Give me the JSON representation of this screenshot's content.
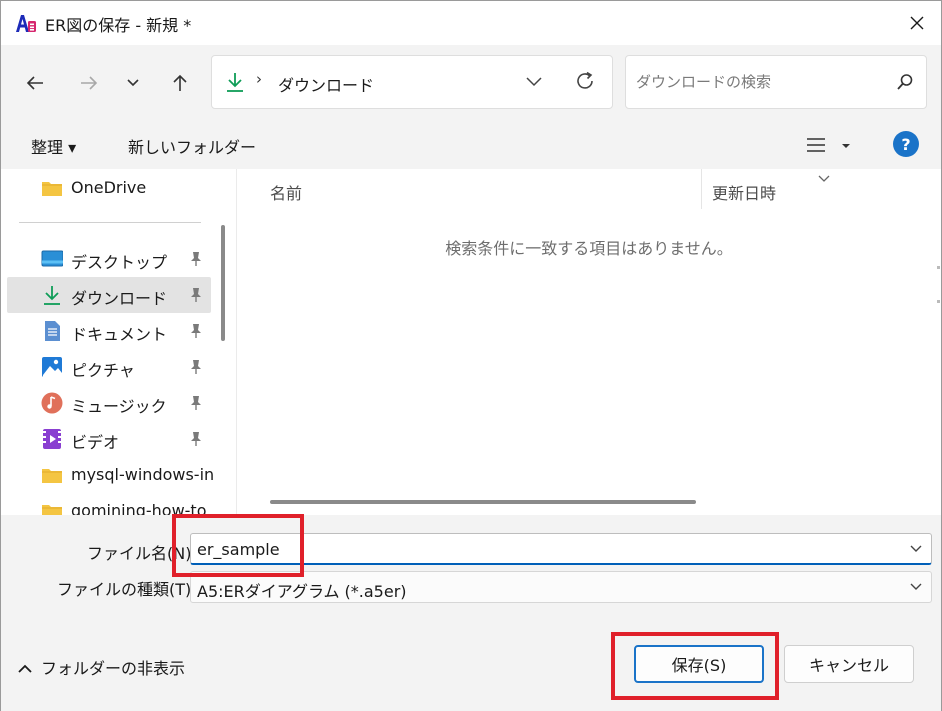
{
  "window": {
    "title": "ER図の保存 - 新規 *",
    "app_icon": "a5er-app-icon",
    "close_icon": "close-icon"
  },
  "nav": {
    "back_icon": "arrow-left-icon",
    "forward_icon": "arrow-right-icon",
    "recent_icon": "chevron-down-icon",
    "up_icon": "arrow-up-icon",
    "address": {
      "location_icon": "download-icon",
      "separator": "›",
      "crumb": "ダウンロード",
      "refresh_icon": "refresh-icon"
    },
    "search": {
      "placeholder": "ダウンロードの検索",
      "value": ""
    }
  },
  "commands": {
    "organize": "整理 ▾",
    "new_folder": "新しいフォルダー",
    "help": "?"
  },
  "sidebar": {
    "items": [
      {
        "label": "OneDrive",
        "icon": "folder-icon",
        "pinned": false
      },
      {
        "label": "デスクトップ",
        "icon": "desktop-icon",
        "pinned": true
      },
      {
        "label": "ダウンロード",
        "icon": "download-icon",
        "pinned": true,
        "selected": true
      },
      {
        "label": "ドキュメント",
        "icon": "document-icon",
        "pinned": true
      },
      {
        "label": "ピクチャ",
        "icon": "pictures-icon",
        "pinned": true
      },
      {
        "label": "ミュージック",
        "icon": "music-icon",
        "pinned": true
      },
      {
        "label": "ビデオ",
        "icon": "video-icon",
        "pinned": true
      },
      {
        "label": "mysql-windows-in",
        "icon": "folder-icon",
        "pinned": false
      },
      {
        "label": "gomining-how-to",
        "icon": "folder-icon",
        "pinned": false
      }
    ]
  },
  "file_list": {
    "columns": [
      "名前",
      "更新日時"
    ],
    "empty_message": "検索条件に一致する項目はありません。"
  },
  "form": {
    "filename_label": "ファイル名(N):",
    "filename_value": "er_sample",
    "filetype_label": "ファイルの種類(T):",
    "filetype_value": "A5:ERダイアグラム (*.a5er)"
  },
  "footer": {
    "hide_folders": "フォルダーの非表示",
    "save": "保存(S)",
    "cancel": "キャンセル"
  },
  "colors": {
    "accent": "#1a73c8",
    "highlight": "#e0202a",
    "download_green": "#0f9d58",
    "folder_yellow": "#f4c542"
  }
}
